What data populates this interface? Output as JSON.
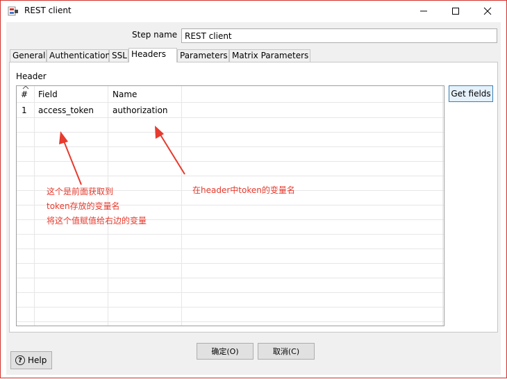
{
  "window": {
    "title": "REST client",
    "accent": "#d0312d"
  },
  "step": {
    "label": "Step name",
    "value": "REST client"
  },
  "tabs": [
    {
      "label": "General"
    },
    {
      "label": "Authentication"
    },
    {
      "label": "SSL"
    },
    {
      "label": "Headers"
    },
    {
      "label": "Parameters"
    },
    {
      "label": "Matrix Parameters"
    }
  ],
  "active_tab": "Headers",
  "headers": {
    "section_label": "Header",
    "columns": [
      "#",
      "Field",
      "Name"
    ],
    "rows": [
      {
        "num": "1",
        "field": "access_token",
        "name": "authorization"
      }
    ],
    "get_fields_label": "Get fields"
  },
  "annotations": {
    "left_line1": "这个是前面获取到",
    "left_line2": "token存放的变量名",
    "left_line3": "将这个值赋值给右边的变量",
    "right": "在header中token的变量名",
    "color": "#e63b2e"
  },
  "buttons": {
    "ok": "确定(O)",
    "cancel": "取消(C)",
    "help": "Help"
  },
  "icons": {
    "app": "rest-client-app-icon",
    "minimize": "minimize-icon",
    "maximize": "maximize-icon",
    "close": "close-icon",
    "sort": "sort-caret-icon",
    "help": "question-circle-icon"
  }
}
